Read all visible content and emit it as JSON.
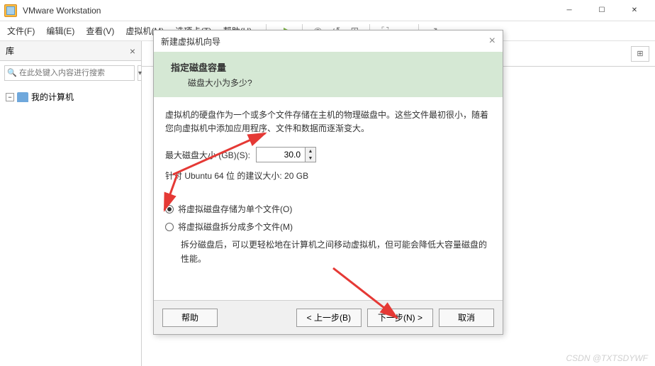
{
  "window": {
    "title": "VMware Workstation"
  },
  "menu": {
    "file": "文件(F)",
    "edit": "编辑(E)",
    "view": "查看(V)",
    "vm": "虚拟机(M)",
    "tabs": "选项卡(T)",
    "help": "帮助(H)"
  },
  "sidebar": {
    "title": "库",
    "search_placeholder": "在此处键入内容进行搜索",
    "tree": {
      "root": "我的计算机"
    }
  },
  "dialog": {
    "title": "新建虚拟机向导",
    "banner_title": "指定磁盘容量",
    "banner_sub": "磁盘大小为多少?",
    "desc": "虚拟机的硬盘作为一个或多个文件存储在主机的物理磁盘中。这些文件最初很小，随着您向虚拟机中添加应用程序、文件和数据而逐渐变大。",
    "max_size_label": "最大磁盘大小 (GB)(S):",
    "max_size_value": "30.0",
    "recommended": "针对 Ubuntu 64 位 的建议大小: 20 GB",
    "radio1": "将虚拟磁盘存储为单个文件(O)",
    "radio2": "将虚拟磁盘拆分成多个文件(M)",
    "radio_help": "拆分磁盘后，可以更轻松地在计算机之间移动虚拟机，但可能会降低大容量磁盘的性能。",
    "buttons": {
      "help": "帮助",
      "back": "< 上一步(B)",
      "next": "下一步(N) >",
      "cancel": "取消"
    }
  },
  "watermark": "CSDN @TXTSDYWF"
}
